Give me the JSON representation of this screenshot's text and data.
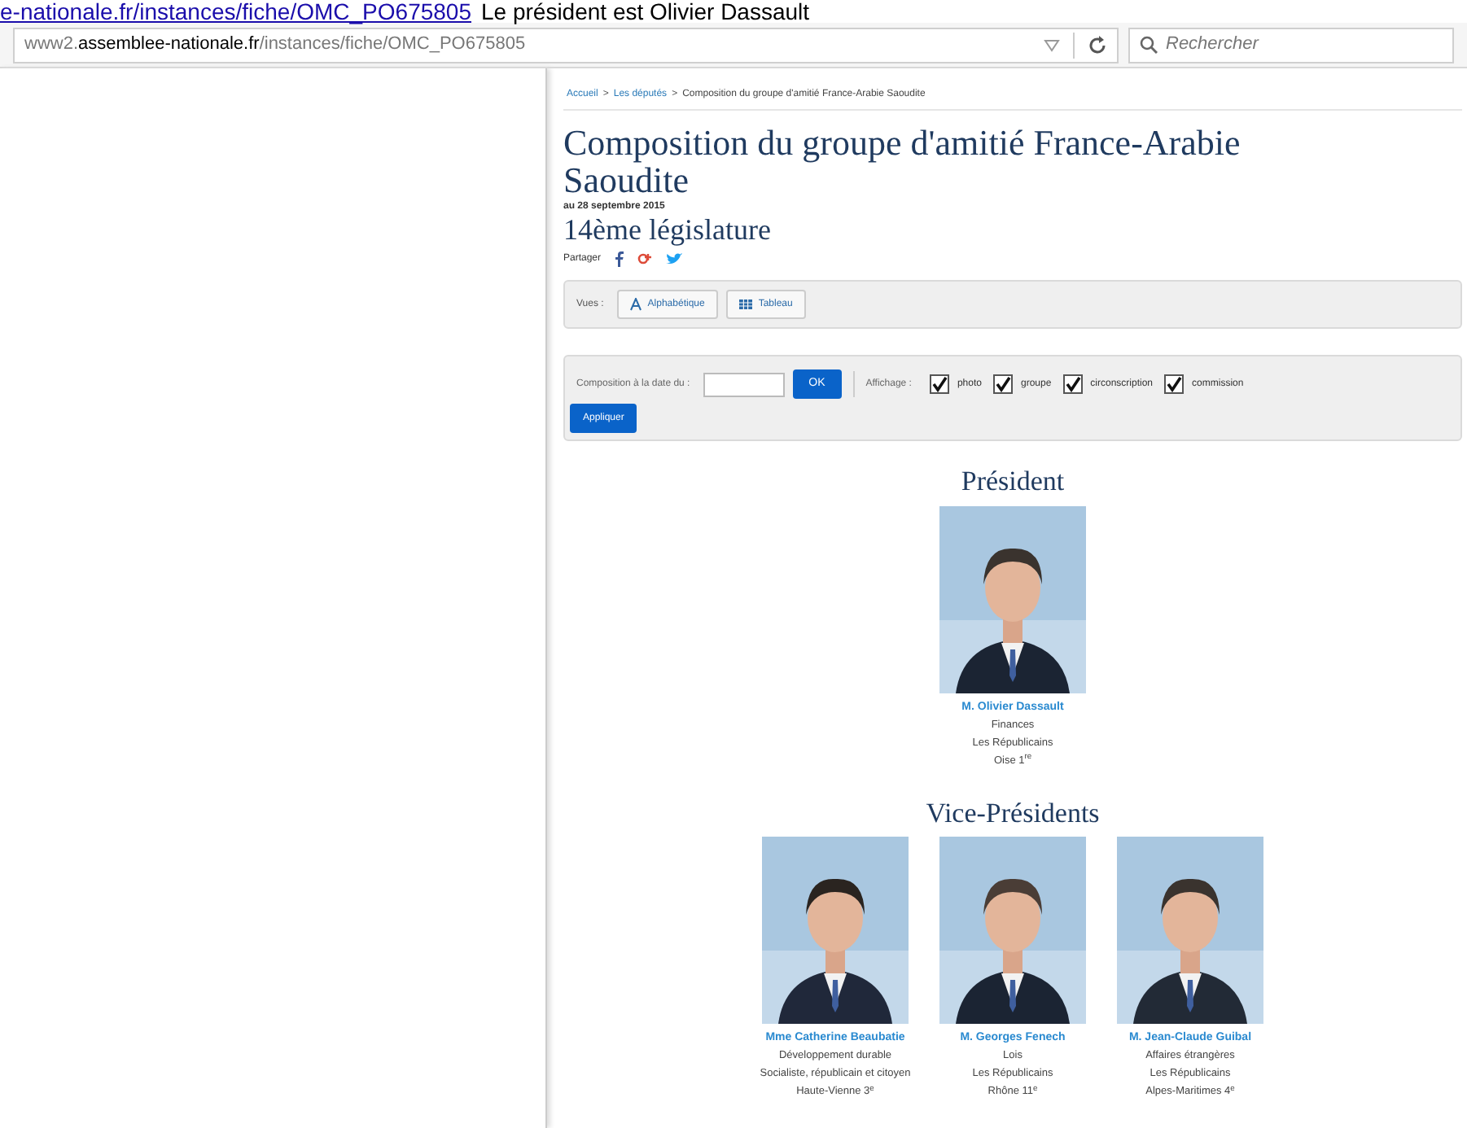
{
  "top_line": {
    "link": "e-nationale.fr/instances/fiche/OMC_PO675805",
    "text": "Le président est Olivier Dassault"
  },
  "browser": {
    "url_prefix": "www2.",
    "url_domain": "assemblee-nationale.fr",
    "url_path": "/instances/fiche/OMC_PO675805",
    "search_placeholder": "Rechercher"
  },
  "breadcrumb_separator": ">",
  "breadcrumb": [
    {
      "label": "Accueil",
      "link": true
    },
    {
      "label": "Les députés",
      "link": true
    },
    {
      "label": "Composition du groupe d'amitié France-Arabie Saoudite",
      "link": false
    }
  ],
  "title": "Composition du groupe d'amitié France-Arabie Saoudite",
  "date": "au 28 septembre 2015",
  "legislature": "14ème législature",
  "share": {
    "label": "Partager"
  },
  "views": {
    "label": "Vues :",
    "buttons": [
      "Alphabétique",
      "Tableau"
    ]
  },
  "composition": {
    "label": "Composition à la date du :",
    "ok": "OK",
    "display_label": "Affichage :",
    "apply": "Appliquer",
    "options": [
      {
        "label": "photo",
        "checked": true
      },
      {
        "label": "groupe",
        "checked": true
      },
      {
        "label": "circonscription",
        "checked": true
      },
      {
        "label": "commission",
        "checked": true
      }
    ]
  },
  "sections": [
    {
      "heading": "Président",
      "members": [
        {
          "name": "M. Olivier Dassault",
          "lines": [
            "Finances",
            "Les Républicains",
            "Oise 1$^{re}$"
          ]
        }
      ]
    },
    {
      "heading": "Vice-Présidents",
      "members": [
        {
          "name": "Mme Catherine Beaubatie",
          "lines": [
            "Développement durable",
            "Socialiste, républicain et citoyen",
            "Haute-Vienne 3$^{e}$"
          ]
        },
        {
          "name": "M. Georges Fenech",
          "lines": [
            "Lois",
            "Les Républicains",
            "Rhône 11$^{e}$"
          ]
        },
        {
          "name": "M. Jean-Claude Guibal",
          "lines": [
            "Affaires étrangères",
            "Les Républicains",
            "Alpes-Maritimes 4$^{e}$"
          ]
        }
      ]
    }
  ]
}
